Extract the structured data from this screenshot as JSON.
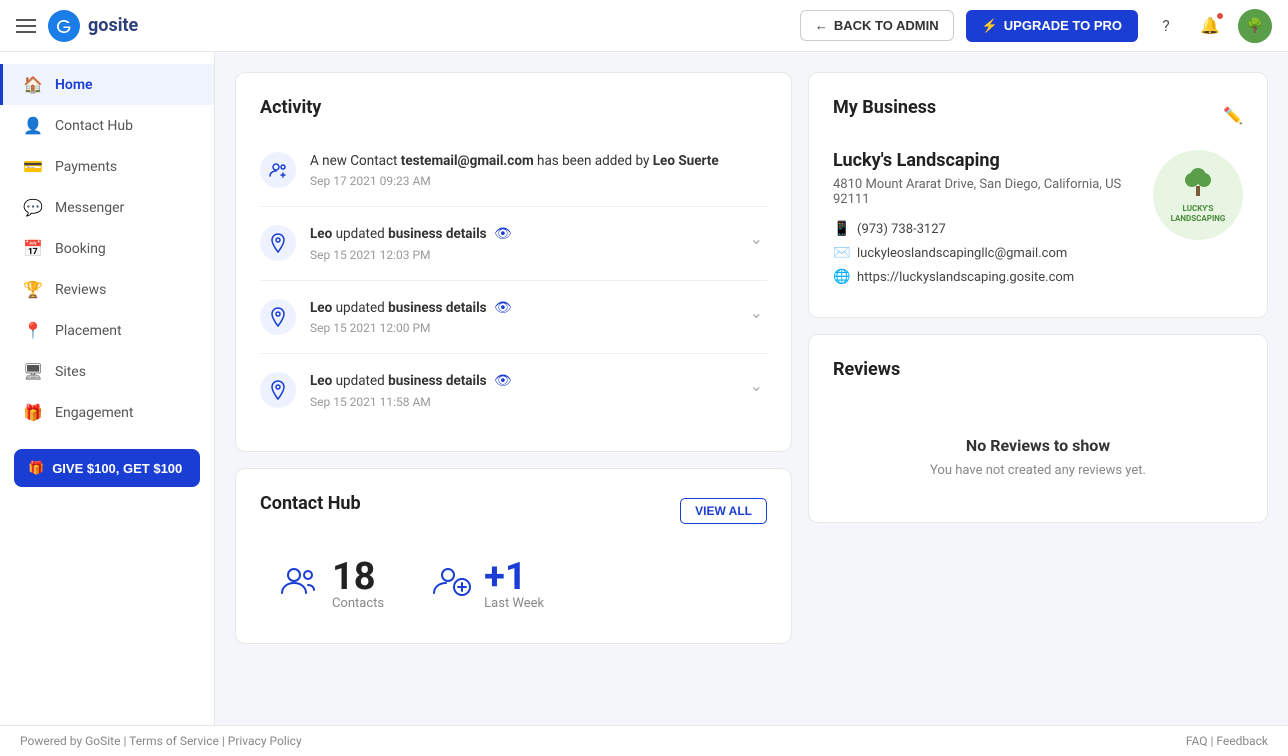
{
  "header": {
    "logo_text": "gosite",
    "back_to_admin": "BACK TO ADMIN",
    "upgrade_to_pro": "UPGRADE TO PRO"
  },
  "sidebar": {
    "items": [
      {
        "id": "home",
        "label": "Home",
        "icon": "🏠",
        "active": true
      },
      {
        "id": "contact-hub",
        "label": "Contact Hub",
        "icon": "👤"
      },
      {
        "id": "payments",
        "label": "Payments",
        "icon": "💳"
      },
      {
        "id": "messenger",
        "label": "Messenger",
        "icon": "💬"
      },
      {
        "id": "booking",
        "label": "Booking",
        "icon": "📅"
      },
      {
        "id": "reviews",
        "label": "Reviews",
        "icon": "🏆"
      },
      {
        "id": "placement",
        "label": "Placement",
        "icon": "📍"
      },
      {
        "id": "sites",
        "label": "Sites",
        "icon": "🖥"
      },
      {
        "id": "engagement",
        "label": "Engagement",
        "icon": "🎁"
      }
    ],
    "give_button": "GIVE $100, GET $100"
  },
  "activity": {
    "title": "Activity",
    "items": [
      {
        "type": "contact",
        "text_prefix": "A new Contact ",
        "email": "testemail@gmail.com",
        "text_middle": " has been added by ",
        "person": "Leo Suerte",
        "timestamp": "Sep 17 2021 09:23 AM"
      },
      {
        "type": "location",
        "person": "Leo",
        "action": "updated",
        "detail": "business details",
        "timestamp": "Sep 15 2021 12:03 PM",
        "has_eye": true
      },
      {
        "type": "location",
        "person": "Leo",
        "action": "updated",
        "detail": "business details",
        "timestamp": "Sep 15 2021 12:00 PM",
        "has_eye": true
      },
      {
        "type": "location",
        "person": "Leo",
        "action": "updated",
        "detail": "business details",
        "timestamp": "Sep 15 2021 11:58 AM",
        "has_eye": true
      }
    ]
  },
  "contact_hub": {
    "title": "Contact Hub",
    "view_all": "VIEW ALL",
    "contacts_count": "18",
    "contacts_label": "Contacts",
    "new_last_week": "+1",
    "new_last_week_label": "Last Week"
  },
  "my_business": {
    "title": "My Business",
    "business_name": "Lucky's Landscaping",
    "address": "4810 Mount Ararat Drive,  San Diego, California, US 92111",
    "phone": "(973) 738-3127",
    "email": "luckyleoslandscapingllc@gmail.com",
    "website": "https://luckyslandscaping.gosite.com",
    "logo_text": "LUCKY'S\nLANDSCAPING"
  },
  "reviews": {
    "title": "Reviews",
    "empty_title": "No Reviews to show",
    "empty_subtitle": "You have not created any reviews yet."
  },
  "footer": {
    "powered_by": "Powered by GoSite",
    "terms": "Terms of Service",
    "privacy": "Privacy Policy",
    "faq": "FAQ",
    "feedback": "Feedback"
  }
}
